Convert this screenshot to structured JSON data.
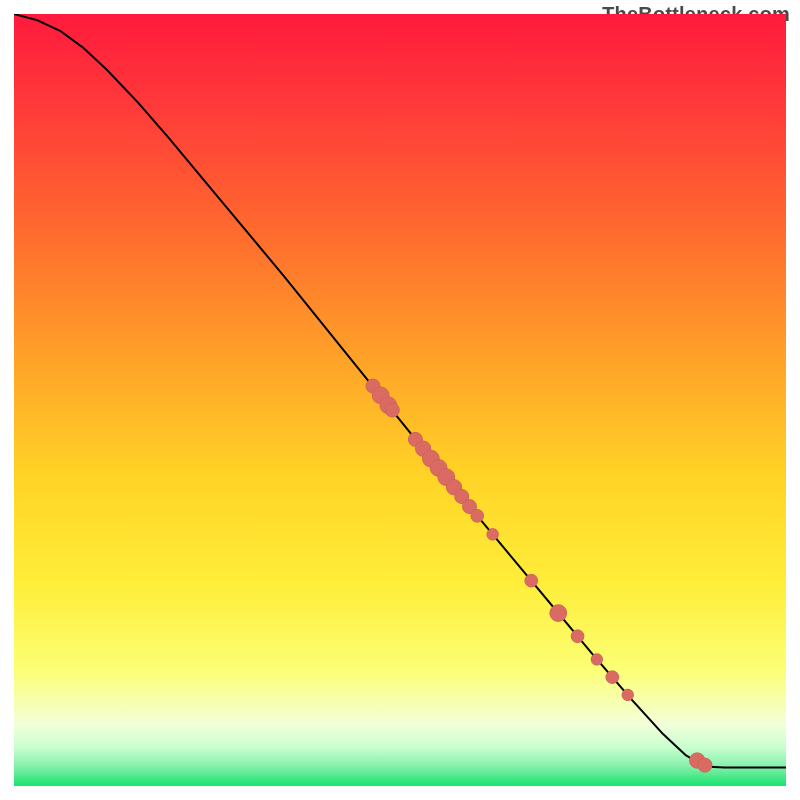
{
  "watermark": "TheBottleneck.com",
  "colors": {
    "gradient_stops": [
      {
        "offset": 0.0,
        "color": "#ff1a3c"
      },
      {
        "offset": 0.12,
        "color": "#ff3a3a"
      },
      {
        "offset": 0.28,
        "color": "#ff6a2e"
      },
      {
        "offset": 0.44,
        "color": "#ffa029"
      },
      {
        "offset": 0.6,
        "color": "#ffd426"
      },
      {
        "offset": 0.74,
        "color": "#ffee3a"
      },
      {
        "offset": 0.85,
        "color": "#fcff75"
      },
      {
        "offset": 0.92,
        "color": "#f2ffd9"
      },
      {
        "offset": 0.95,
        "color": "#c9ffd0"
      },
      {
        "offset": 0.975,
        "color": "#83f0a9"
      },
      {
        "offset": 1.0,
        "color": "#19e36e"
      }
    ],
    "curve": "#000000",
    "marker_fill": "#d96b63",
    "marker_stroke": "#c55a52"
  },
  "chart_data": {
    "type": "line",
    "title": "",
    "xlabel": "",
    "ylabel": "",
    "xlim": [
      0,
      100
    ],
    "ylim": [
      0,
      100
    ],
    "grid": false,
    "curve": [
      {
        "x": 0.0,
        "y": 100.0
      },
      {
        "x": 3.0,
        "y": 99.2
      },
      {
        "x": 6.0,
        "y": 97.8
      },
      {
        "x": 9.0,
        "y": 95.6
      },
      {
        "x": 12.0,
        "y": 92.8
      },
      {
        "x": 16.0,
        "y": 88.6
      },
      {
        "x": 20.0,
        "y": 84.0
      },
      {
        "x": 25.0,
        "y": 78.0
      },
      {
        "x": 30.0,
        "y": 72.0
      },
      {
        "x": 35.0,
        "y": 66.0
      },
      {
        "x": 40.0,
        "y": 59.8
      },
      {
        "x": 45.0,
        "y": 53.6
      },
      {
        "x": 50.0,
        "y": 47.4
      },
      {
        "x": 55.0,
        "y": 41.2
      },
      {
        "x": 60.0,
        "y": 35.0
      },
      {
        "x": 65.0,
        "y": 29.0
      },
      {
        "x": 70.0,
        "y": 23.0
      },
      {
        "x": 75.0,
        "y": 17.0
      },
      {
        "x": 80.0,
        "y": 11.2
      },
      {
        "x": 84.0,
        "y": 6.8
      },
      {
        "x": 87.0,
        "y": 4.0
      },
      {
        "x": 89.0,
        "y": 2.8
      },
      {
        "x": 90.0,
        "y": 2.5
      },
      {
        "x": 92.0,
        "y": 2.4
      },
      {
        "x": 95.0,
        "y": 2.4
      },
      {
        "x": 100.0,
        "y": 2.4
      }
    ],
    "markers": [
      {
        "x": 46.5,
        "y": 51.8,
        "r": 1.1
      },
      {
        "x": 47.5,
        "y": 50.6,
        "r": 1.3
      },
      {
        "x": 48.5,
        "y": 49.3,
        "r": 1.3
      },
      {
        "x": 49.0,
        "y": 48.7,
        "r": 1.1
      },
      {
        "x": 52.0,
        "y": 44.9,
        "r": 1.1
      },
      {
        "x": 53.0,
        "y": 43.7,
        "r": 1.2
      },
      {
        "x": 54.0,
        "y": 42.4,
        "r": 1.3
      },
      {
        "x": 55.0,
        "y": 41.2,
        "r": 1.3
      },
      {
        "x": 56.0,
        "y": 40.0,
        "r": 1.3
      },
      {
        "x": 57.0,
        "y": 38.7,
        "r": 1.2
      },
      {
        "x": 58.0,
        "y": 37.5,
        "r": 1.1
      },
      {
        "x": 59.0,
        "y": 36.2,
        "r": 1.1
      },
      {
        "x": 60.0,
        "y": 35.0,
        "r": 1.0
      },
      {
        "x": 62.0,
        "y": 32.6,
        "r": 0.9
      },
      {
        "x": 67.0,
        "y": 26.6,
        "r": 1.0
      },
      {
        "x": 70.5,
        "y": 22.4,
        "r": 1.3
      },
      {
        "x": 73.0,
        "y": 19.4,
        "r": 1.0
      },
      {
        "x": 75.5,
        "y": 16.4,
        "r": 0.9
      },
      {
        "x": 77.5,
        "y": 14.1,
        "r": 1.0
      },
      {
        "x": 79.5,
        "y": 11.8,
        "r": 0.9
      },
      {
        "x": 88.5,
        "y": 3.3,
        "r": 1.2
      },
      {
        "x": 89.5,
        "y": 2.7,
        "r": 1.1
      }
    ]
  }
}
